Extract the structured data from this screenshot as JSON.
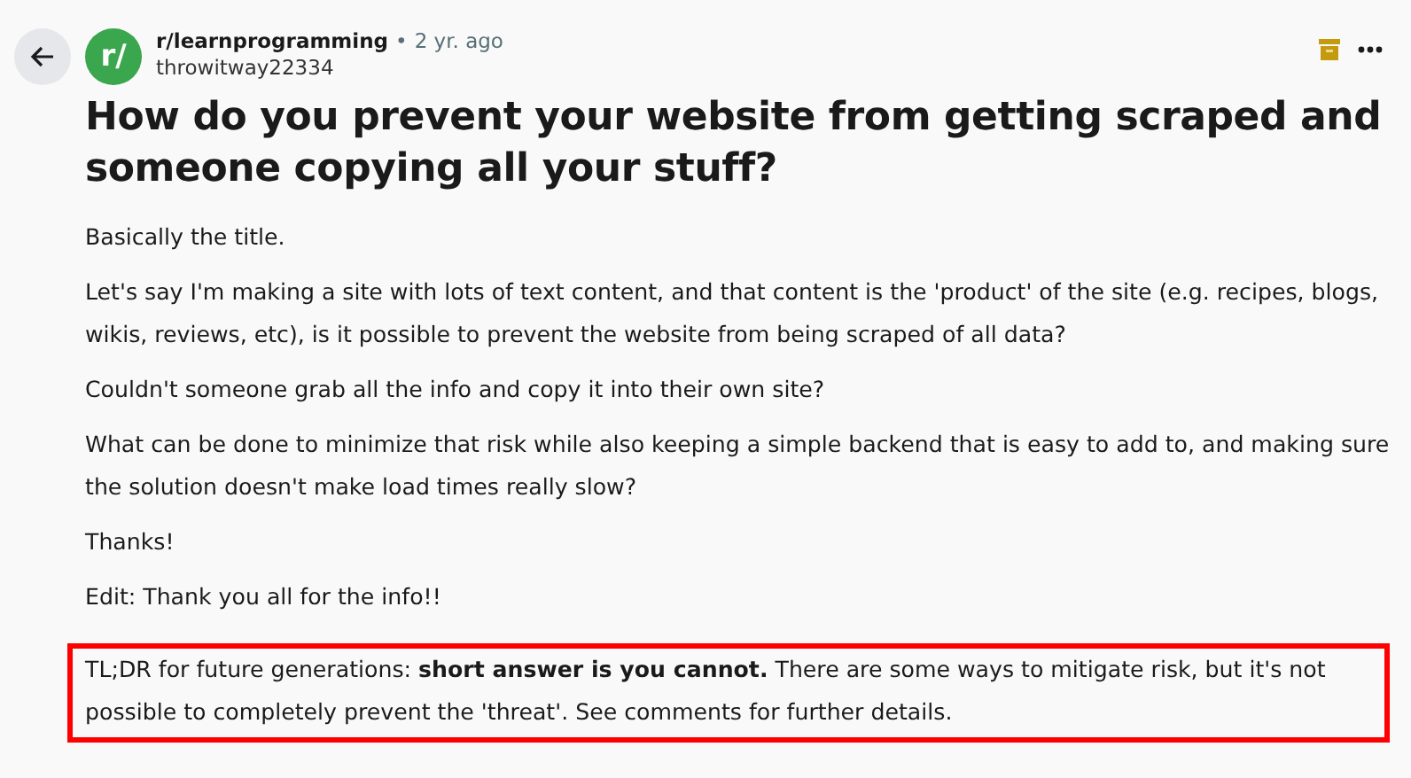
{
  "post": {
    "subreddit": "r/learnprogramming",
    "avatar_text": "r/",
    "separator": "•",
    "age": "2 yr. ago",
    "author": "throwitway22334",
    "title": "How do you prevent your website from getting scraped and someone copying all your stuff?",
    "paragraphs": [
      {
        "text": "Basically the title.",
        "highlighted": false
      },
      {
        "text": "Let's say I'm making a site with lots of text content, and that content is the 'product' of the site (e.g. recipes, blogs, wikis, reviews, etc), is it possible to prevent the website from being scraped of all data?",
        "highlighted": false
      },
      {
        "text": "Couldn't someone grab all the info and copy it into their own site?",
        "highlighted": false
      },
      {
        "text": "What can be done to minimize that risk while also keeping a simple backend that is easy to add to, and making sure the solution doesn't make load times really slow?",
        "highlighted": false
      },
      {
        "text": "Thanks!",
        "highlighted": false
      },
      {
        "text": "Edit: Thank you all for the info!!",
        "highlighted": false
      },
      {
        "text": "TL;DR for future generations: **short answer is you cannot.** There are some ways to mitigate risk, but it's not possible to completely prevent the 'threat'. See comments for further details.",
        "highlighted": true
      }
    ]
  }
}
